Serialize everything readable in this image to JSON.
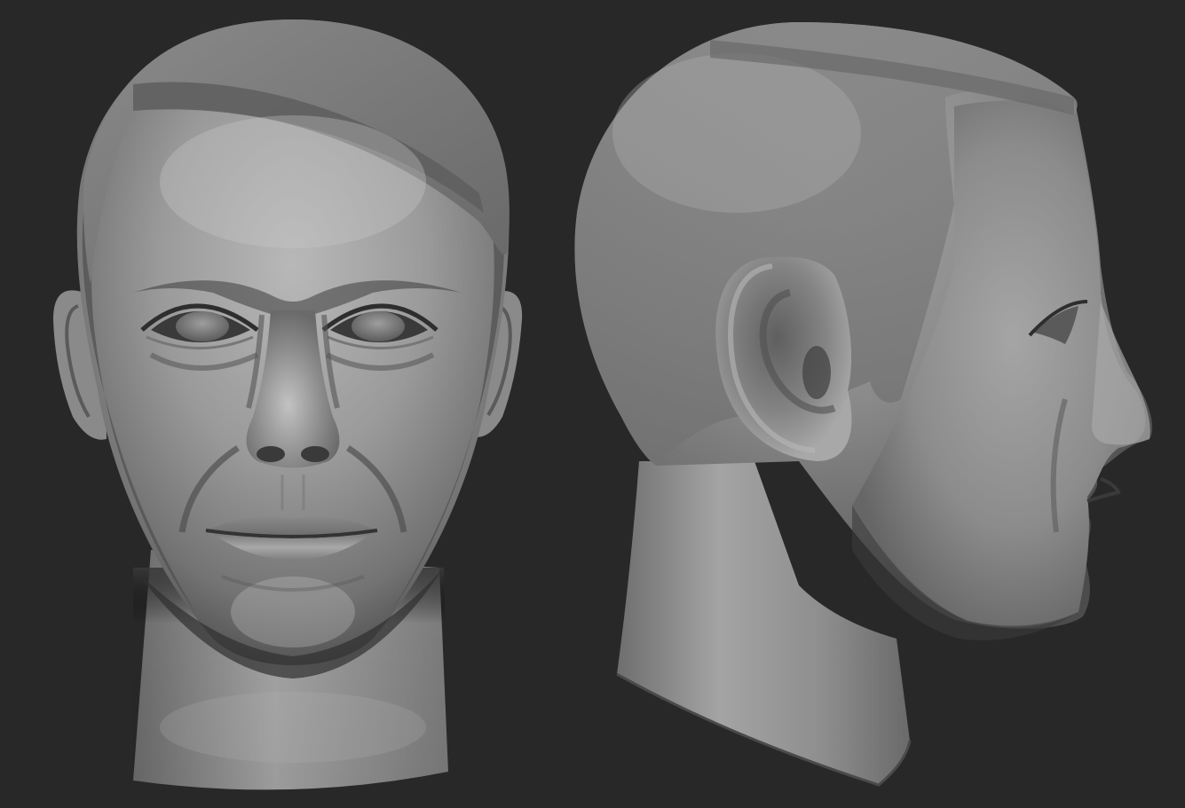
{
  "scene": {
    "background": "#282828",
    "material_color": "#8e8e8e",
    "highlight_color": "#c4c4c4",
    "shadow_color": "#2a2a2a",
    "hair_color": "#7a7a7a"
  },
  "views": [
    {
      "view": "front",
      "subject": "sculpted-male-head"
    },
    {
      "view": "side",
      "subject": "sculpted-male-head"
    }
  ]
}
